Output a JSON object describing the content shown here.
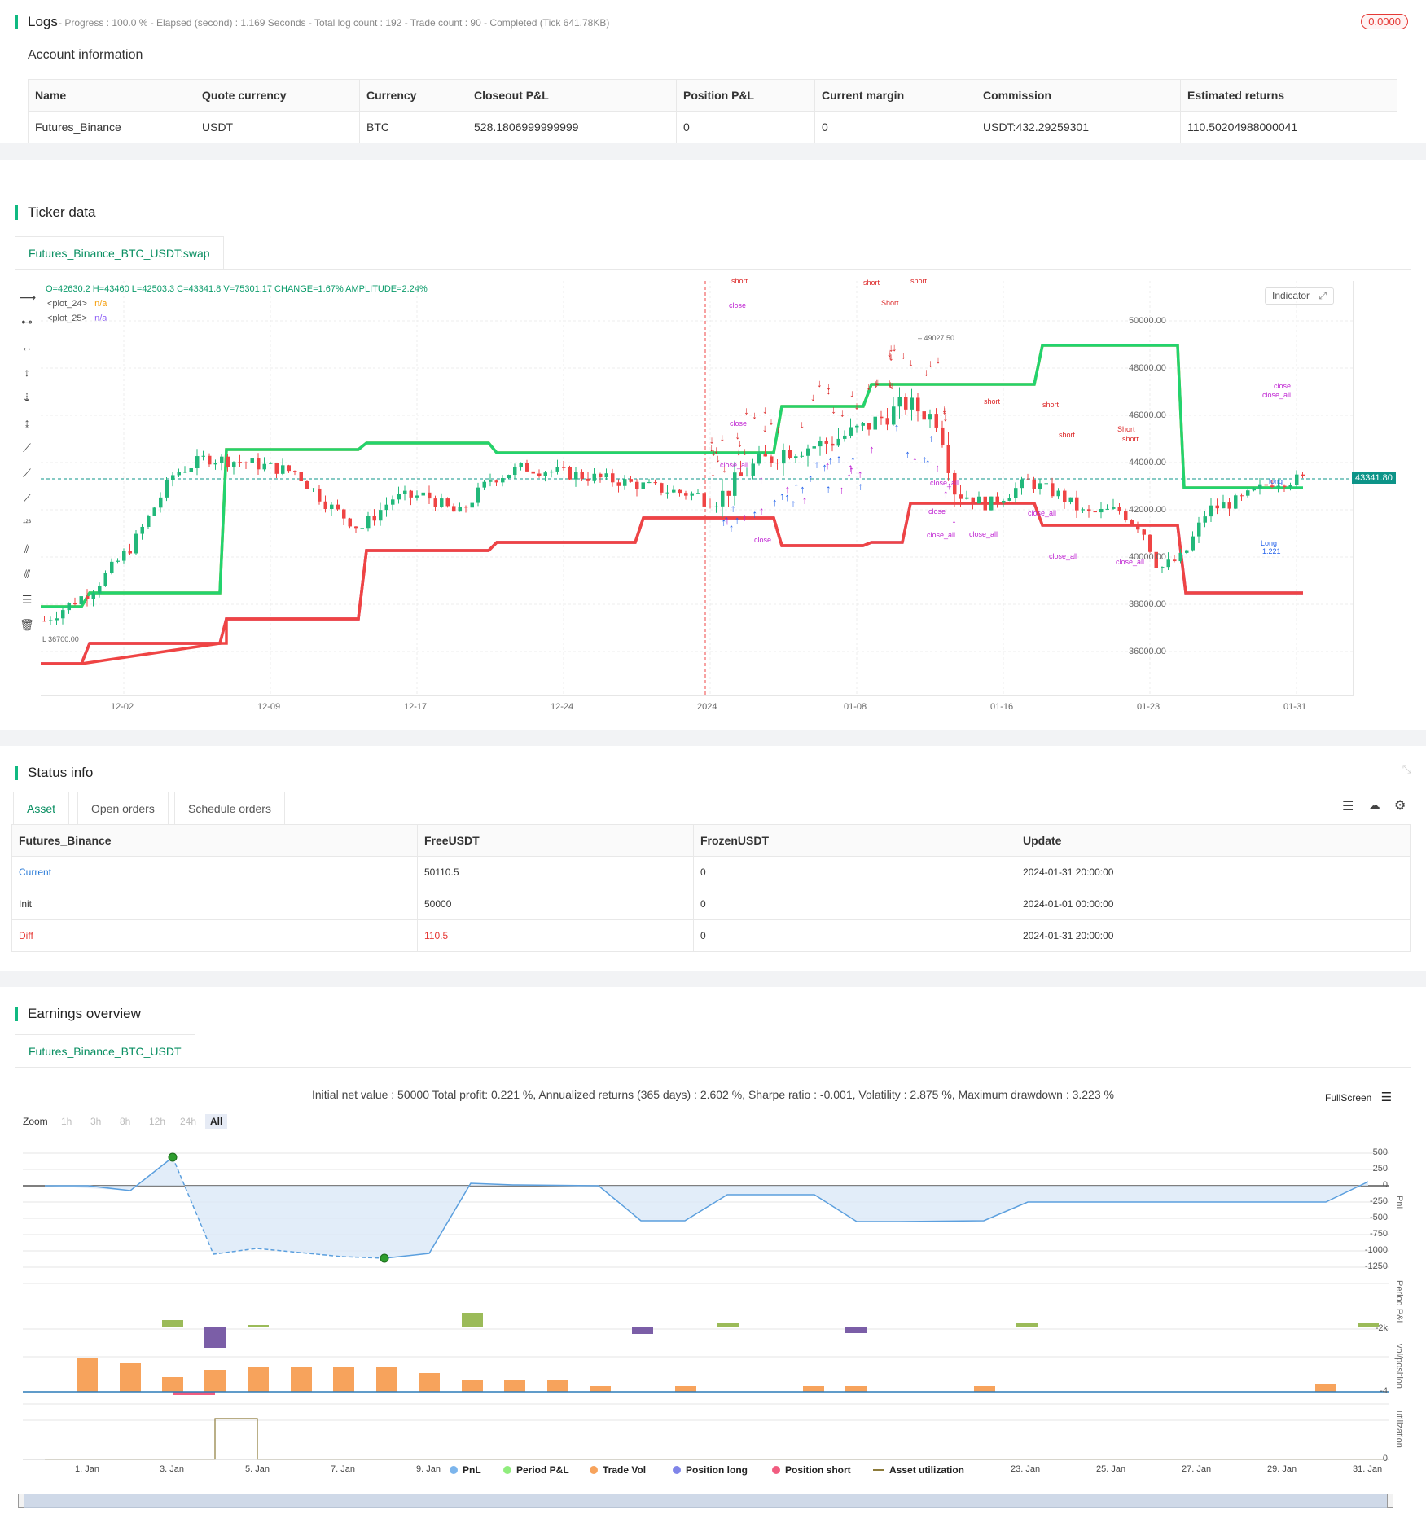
{
  "logs": {
    "title": "Logs",
    "meta": "- Progress : 100.0 % - Elapsed (second) : 1.169  Seconds - Total log count : 192 - Trade count : 90 - Completed (Tick 641.78KB)",
    "badge": "0.0000"
  },
  "account": {
    "title": "Account information",
    "headers": [
      "Name",
      "Quote currency",
      "Currency",
      "Closeout P&L",
      "Position P&L",
      "Current margin",
      "Commission",
      "Estimated returns"
    ],
    "row": [
      "Futures_Binance",
      "USDT",
      "BTC",
      "528.1806999999999",
      "0",
      "0",
      "USDT:432.29259301",
      "110.50204988000041"
    ]
  },
  "ticker": {
    "title": "Ticker data",
    "tab": "Futures_Binance_BTC_USDT:swap",
    "ohlc": "O=42630.2 H=43460 L=42503.3 C=43341.8 V=75301.17 CHANGE=1.67% AMPLITUDE=2.24%",
    "plot24_name": "<plot_24>",
    "plot24_val": "n/a",
    "plot25_name": "<plot_25>",
    "plot25_val": "n/a",
    "indicator_btn": "Indicator",
    "price_tag": "43341.80",
    "high_mark": "49027.50",
    "low_mark": "36700.00",
    "y_labels": [
      "50000.00",
      "48000.00",
      "46000.00",
      "44000.00",
      "42000.00",
      "40000.00",
      "38000.00",
      "36000.00"
    ],
    "x_labels": [
      "12-02",
      "12-09",
      "12-17",
      "12-24",
      "2024",
      "01-08",
      "01-16",
      "01-23",
      "01-31"
    ]
  },
  "status": {
    "title": "Status info",
    "tabs": [
      "Asset",
      "Open orders",
      "Schedule orders"
    ],
    "headers": [
      "Futures_Binance",
      "FreeUSDT",
      "FrozenUSDT",
      "Update"
    ],
    "rows": [
      [
        "Current",
        "50110.5",
        "0",
        "2024-01-31 20:00:00"
      ],
      [
        "Init",
        "50000",
        "0",
        "2024-01-01 00:00:00"
      ],
      [
        "Diff",
        "110.5",
        "0",
        "2024-01-31 20:00:00"
      ]
    ]
  },
  "earnings": {
    "title": "Earnings overview",
    "tab": "Futures_Binance_BTC_USDT",
    "summary": "Initial net value : 50000 Total profit: 0.221 %, Annualized returns (365 days) : 2.602 %, Sharpe ratio : -0.001, Volatility : 2.875 %, Maximum drawdown : 3.223 %",
    "fullscreen": "FullScreen",
    "zoom_label": "Zoom",
    "zoom_opts": [
      "1h",
      "3h",
      "8h",
      "12h",
      "24h",
      "All"
    ],
    "pnl_ticks": [
      "500",
      "250",
      "0",
      "-250",
      "-500",
      "-750",
      "-1000",
      "-1250"
    ],
    "period_tick": "-2k",
    "vol_tick": "-4",
    "util_tick": "0",
    "axis_titles": [
      "PnL",
      "Period P&L",
      "vol/position",
      "utilization"
    ],
    "x_labels": [
      "1. Jan",
      "3. Jan",
      "5. Jan",
      "7. Jan",
      "9. Jan",
      "11. Jan",
      "13. Jan",
      "15. Jan",
      "17. Jan",
      "19. Jan",
      "21. Jan",
      "23. Jan",
      "25. Jan",
      "27. Jan",
      "29. Jan",
      "31. Jan"
    ],
    "legend": [
      {
        "label": "PnL",
        "color": "#7cb5ec"
      },
      {
        "label": "Period P&L",
        "color": "#90ed7d"
      },
      {
        "label": "Trade Vol",
        "color": "#f7a35c"
      },
      {
        "label": "Position long",
        "color": "#8085e9"
      },
      {
        "label": "Position short",
        "color": "#f15c80"
      },
      {
        "label": "Asset utilization",
        "color": "#8d7b3a"
      }
    ]
  },
  "chart_data": [
    {
      "type": "line",
      "title": "",
      "series": [
        {
          "name": "PnL",
          "x": [
            "1. Jan",
            "2. Jan",
            "3. Jan",
            "4. Jan",
            "5. Jan",
            "6. Jan",
            "7. Jan",
            "8. Jan",
            "9. Jan",
            "10. Jan",
            "12. Jan",
            "13. Jan",
            "14. Jan",
            "16. Jan",
            "18. Jan",
            "19. Jan",
            "21. Jan",
            "22. Jan",
            "23. Jan",
            "31. Jan"
          ],
          "values": [
            0,
            -80,
            400,
            -1100,
            -1000,
            -1100,
            -1150,
            -1200,
            -1150,
            0,
            -10,
            0,
            -500,
            -500,
            -100,
            -100,
            -600,
            -600,
            -250,
            110
          ]
        }
      ],
      "ylim": [
        -1250,
        500
      ]
    }
  ]
}
